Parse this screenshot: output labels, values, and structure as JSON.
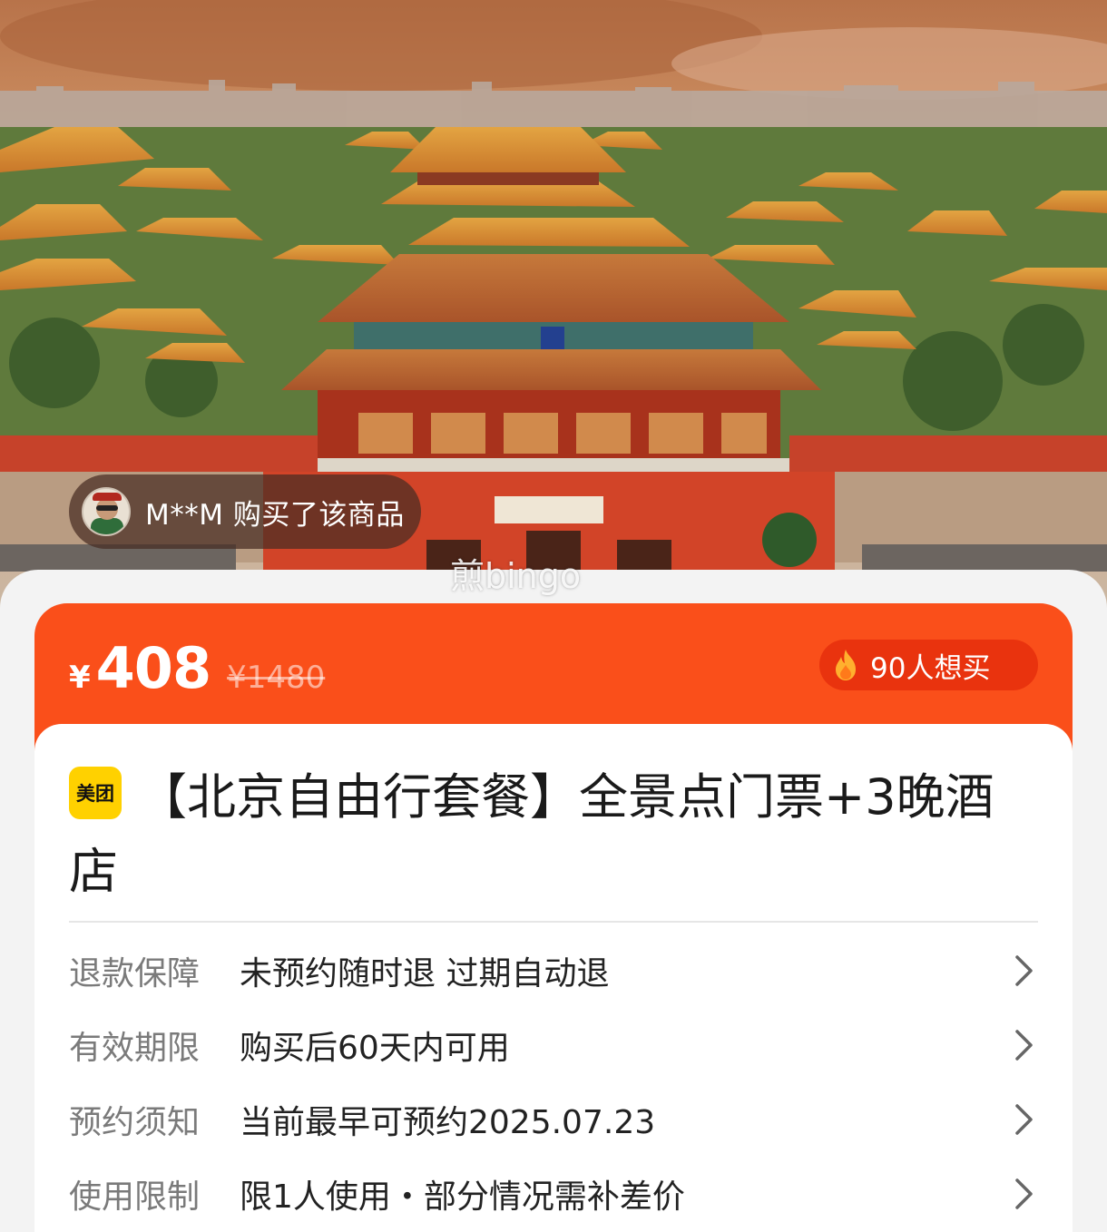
{
  "buyer": {
    "text": "M**M 购买了该商品"
  },
  "watermark": "煎bingo",
  "price": {
    "currency": "¥",
    "current": "408",
    "original": "¥1480",
    "want_text": "90人想买"
  },
  "product": {
    "brand_badge": "美团",
    "title": "【北京自由行套餐】全景点门票+3晚酒店"
  },
  "info_rows": [
    {
      "label": "退款保障",
      "value": "未预约随时退 过期自动退"
    },
    {
      "label": "有效期限",
      "value": "购买后60天内可用"
    },
    {
      "label": "预约须知",
      "value": "当前最早可预约2025.07.23"
    },
    {
      "label": "使用限制",
      "value": "限1人使用・部分情况需补差价"
    }
  ],
  "colors": {
    "accent": "#fa4f1a",
    "accent_dark": "#e9330e",
    "brand_yellow": "#ffd100"
  },
  "icons": {
    "hero": "forbidden-city-photo",
    "want": "fire-icon",
    "row": "chevron-right-icon"
  }
}
